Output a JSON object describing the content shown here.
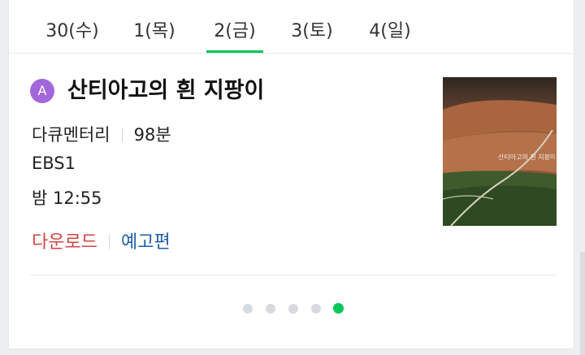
{
  "tabs": [
    {
      "label": "30(수)",
      "active": false
    },
    {
      "label": "1(목)",
      "active": false
    },
    {
      "label": "2(금)",
      "active": true
    },
    {
      "label": "3(토)",
      "active": false
    },
    {
      "label": "4(일)",
      "active": false
    }
  ],
  "program": {
    "badge": "A",
    "title": "산티아고의 흰 지팡이",
    "genre": "다큐멘터리",
    "duration": "98분",
    "channel": "EBS1",
    "airtime": "밤 12:55",
    "poster_title": "산티아고의 흰 지팡이"
  },
  "links": {
    "download": "다운로드",
    "trailer": "예고편"
  },
  "pagination": {
    "total": 5,
    "current": 5
  },
  "colors": {
    "accent_green": "#03c75a",
    "badge_purple": "#a367dc",
    "download_red": "#d24545",
    "trailer_blue": "#1f5ea6"
  }
}
